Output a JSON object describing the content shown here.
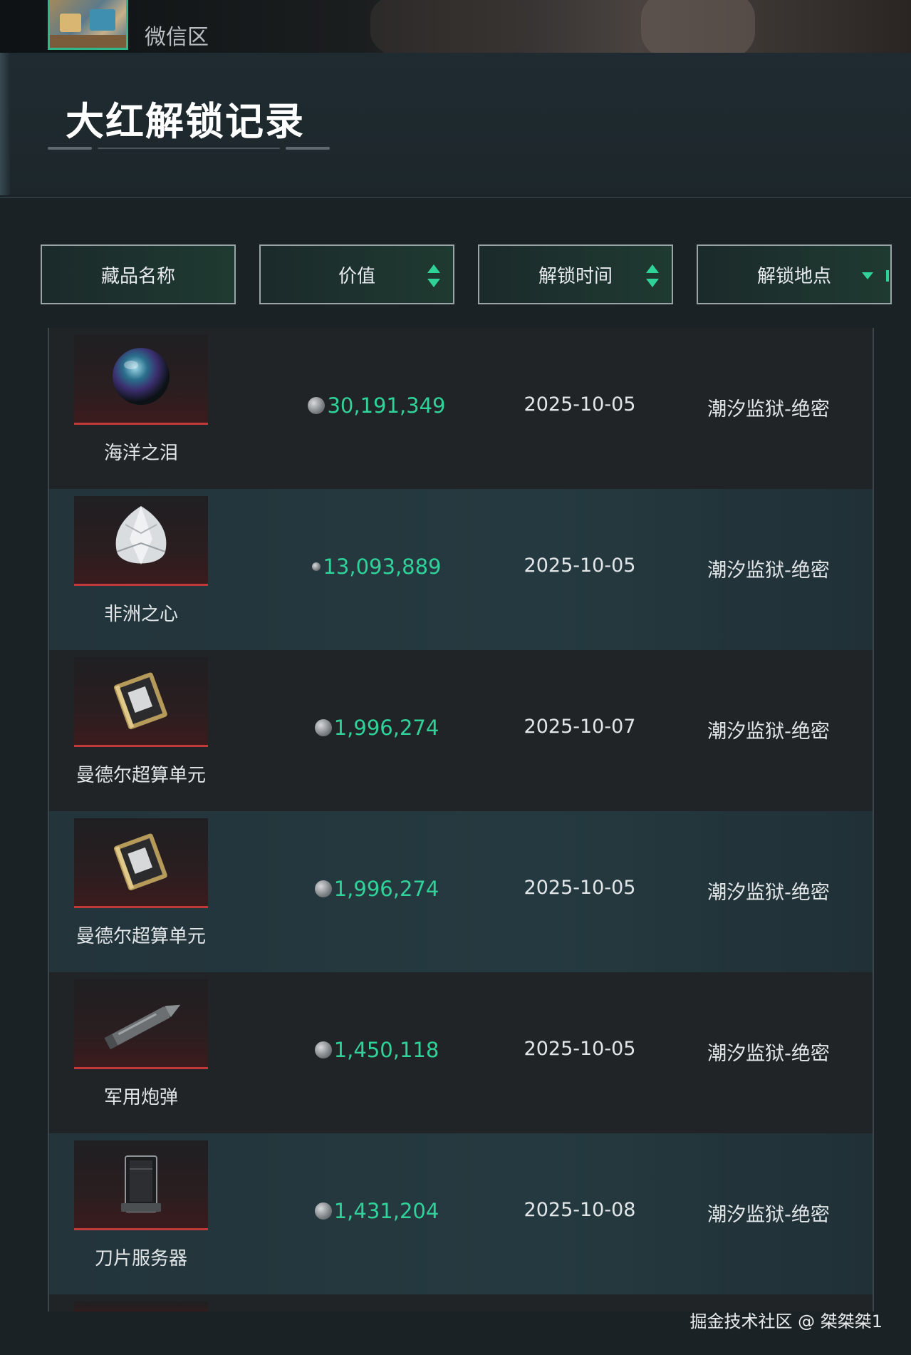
{
  "top_bar": {
    "zone_label": "微信区"
  },
  "header": {
    "title": "大红解锁记录"
  },
  "filters": [
    {
      "label": "藏品名称",
      "control": "none"
    },
    {
      "label": "价值",
      "control": "sort"
    },
    {
      "label": "解锁时间",
      "control": "sort"
    },
    {
      "label": "解锁地点",
      "control": "dropdown"
    }
  ],
  "records": [
    {
      "name": "海洋之泪",
      "icon": "pearl-icon",
      "value": "30,191,349",
      "date": "2025-10-05",
      "location": "潮汐监狱-绝密"
    },
    {
      "name": "非洲之心",
      "icon": "diamond-icon",
      "value": "13,093,889",
      "date": "2025-10-05",
      "location": "潮汐监狱-绝密"
    },
    {
      "name": "曼德尔超算单元",
      "icon": "compute-unit-icon",
      "value": "1,996,274",
      "date": "2025-10-07",
      "location": "潮汐监狱-绝密"
    },
    {
      "name": "曼德尔超算单元",
      "icon": "compute-unit-icon",
      "value": "1,996,274",
      "date": "2025-10-05",
      "location": "潮汐监狱-绝密"
    },
    {
      "name": "军用炮弹",
      "icon": "artillery-shell-icon",
      "value": "1,450,118",
      "date": "2025-10-05",
      "location": "潮汐监狱-绝密"
    },
    {
      "name": "刀片服务器",
      "icon": "blade-server-icon",
      "value": "1,431,204",
      "date": "2025-10-08",
      "location": "潮汐监狱-绝密"
    }
  ],
  "watermark": "掘金技术社区 @ 桀桀桀1",
  "colors": {
    "accent_green": "#2fd39a",
    "rarity_red": "#c03a3a",
    "row_dark": "#202427",
    "row_light": "#253a40"
  }
}
